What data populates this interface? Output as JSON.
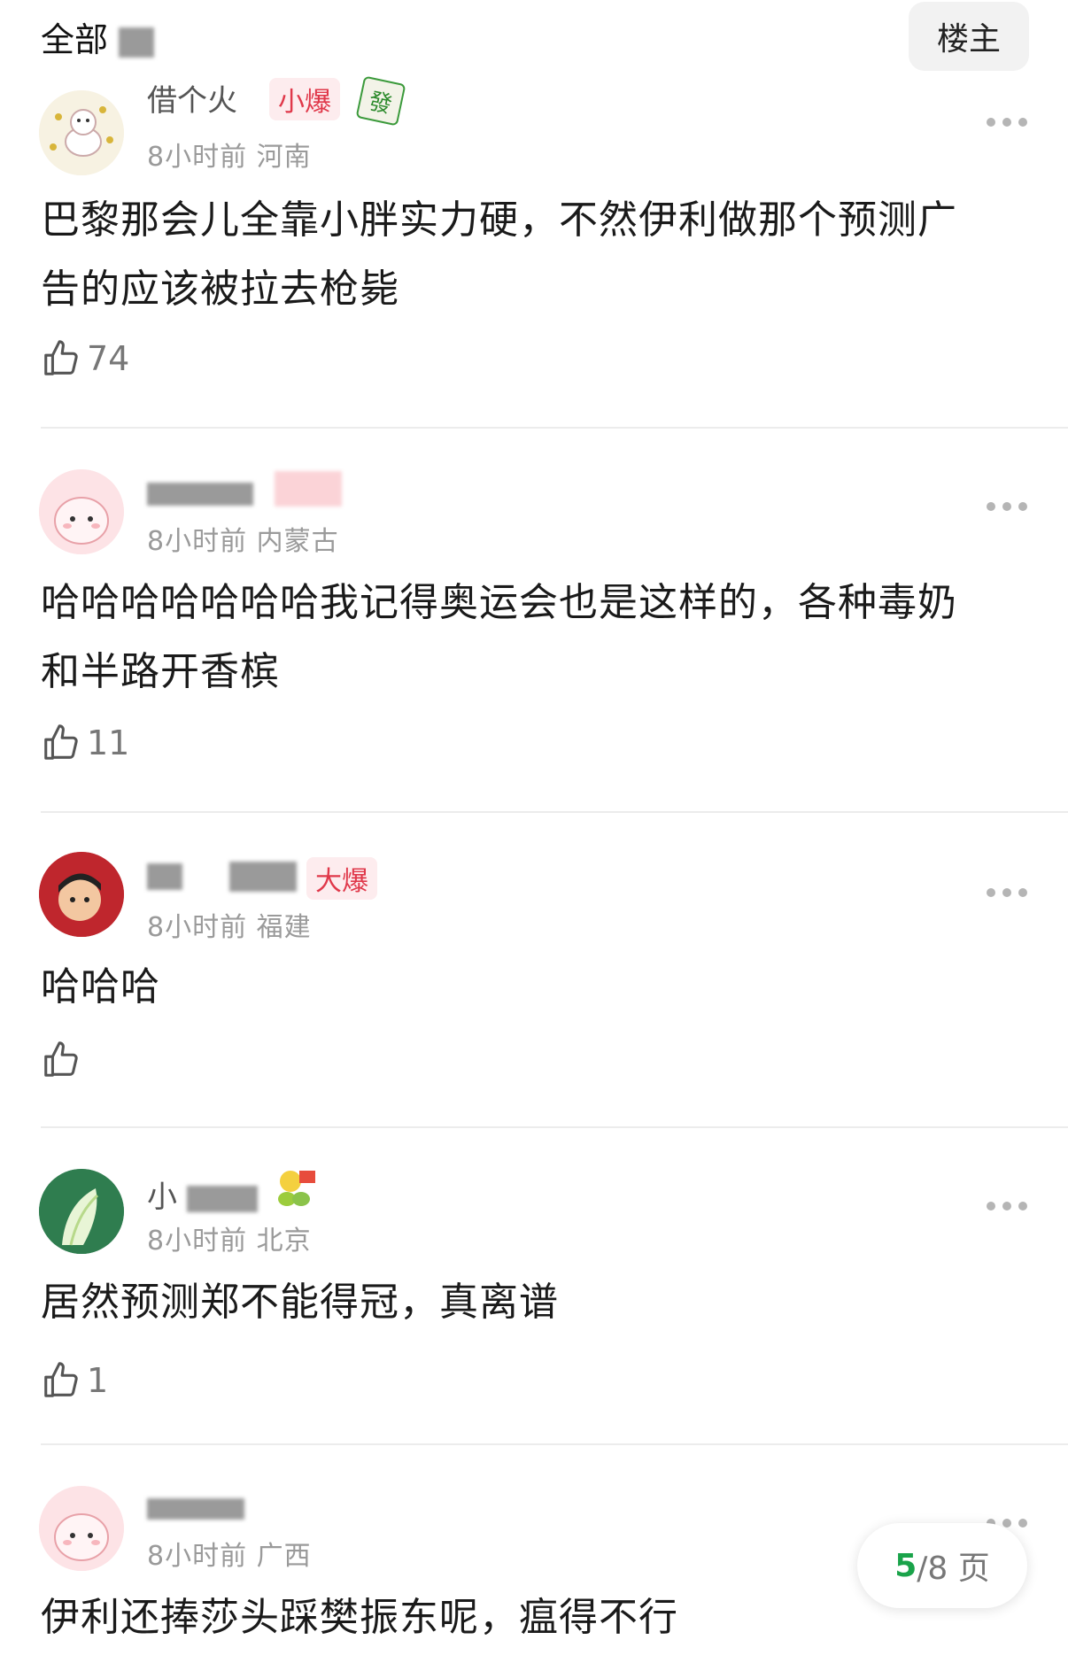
{
  "header": {
    "filter_label": "全部",
    "author_only_button": "楼主"
  },
  "comments": [
    {
      "username": "借个火",
      "badge": "小爆",
      "time": "8小时前",
      "location": "河南",
      "text_line1": "巴黎那会儿全靠小胖实力硬，不然伊利做那个预测广",
      "text_line2": "告的应该被拉去枪毙",
      "likes": "74"
    },
    {
      "username": "",
      "badge": "",
      "time": "8小时前",
      "location": "内蒙古",
      "text_line1": "哈哈哈哈哈哈哈我记得奥运会也是这样的，各种毒奶",
      "text_line2": "和半路开香槟",
      "likes": "11"
    },
    {
      "username": "",
      "badge": "大爆",
      "time": "8小时前",
      "location": "福建",
      "text_line1": "哈哈哈",
      "text_line2": "",
      "likes": ""
    },
    {
      "username": "小",
      "badge": "",
      "time": "8小时前",
      "location": "北京",
      "text_line1": "居然预测郑不能得冠，真离谱",
      "text_line2": "",
      "likes": "1"
    },
    {
      "username": "",
      "badge": "",
      "time": "8小时前",
      "location": "广西",
      "text_line1": "伊利还捧莎头踩樊振东呢，瘟得不行",
      "text_line2": "",
      "likes": ""
    }
  ],
  "pagination": {
    "current": "5",
    "total": "/8 页"
  },
  "colors": {
    "badge_red": "#e0384a",
    "page_green": "#1aa34a"
  },
  "icons": {
    "like": "thumbs-up-icon",
    "more": "more-dots-icon"
  }
}
